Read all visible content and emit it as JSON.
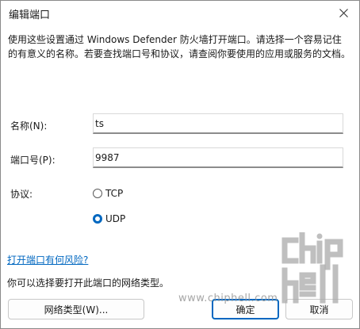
{
  "window": {
    "title": "编辑端口"
  },
  "description": "使用这些设置通过 Windows Defender 防火墙打开端口。请选择一个容易记住的有意义的名称。若要查找端口号和协议，请查阅你要使用的应用或服务的文档。",
  "fields": {
    "name_label": "名称(N):",
    "name_value": "ts",
    "port_label": "端口号(P):",
    "port_value": "9987"
  },
  "protocol": {
    "label": "协议:",
    "options": [
      {
        "label": "TCP",
        "checked": false
      },
      {
        "label": "UDP",
        "checked": true
      }
    ]
  },
  "risk_link": "打开端口有何风险?",
  "network_note": "你可以选择要打开此端口的网络类型。",
  "buttons": {
    "network_type": "网络类型(W)...",
    "ok": "确定",
    "cancel": "取消"
  },
  "watermark": {
    "text": "www.chiphell.com",
    "logo_text": "chip hell"
  },
  "colors": {
    "accent": "#0067c0",
    "link": "#0067c0"
  }
}
